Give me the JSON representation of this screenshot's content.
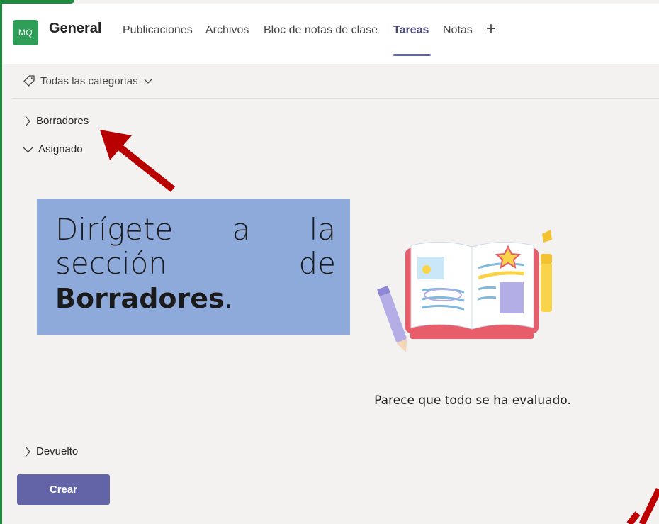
{
  "header": {
    "avatar_initials": "MQ",
    "team_name": "General",
    "tabs": [
      {
        "label": "Publicaciones"
      },
      {
        "label": "Archivos"
      },
      {
        "label": "Bloc de notas de clase"
      },
      {
        "label": "Tareas",
        "active": true
      },
      {
        "label": "Notas"
      }
    ],
    "add_tab_symbol": "+"
  },
  "filter": {
    "label": "Todas las categorías",
    "icon": "tag-icon"
  },
  "sections": {
    "drafts": "Borradores",
    "assigned": "Asignado",
    "returned": "Devuelto"
  },
  "callout": {
    "line1_words": [
      "Dirígete",
      "a",
      "la"
    ],
    "line2_words": [
      "sección",
      "de"
    ],
    "line3_bold": "Borradores",
    "line3_end": "."
  },
  "empty_state": {
    "message": "Parece que todo se ha evaluado."
  },
  "create_button": {
    "label": "Crear"
  },
  "colors": {
    "accent": "#6264a7",
    "callout_bg": "#8eaadb",
    "arrow": "#c00000",
    "frame_green": "#1e8a3c"
  }
}
